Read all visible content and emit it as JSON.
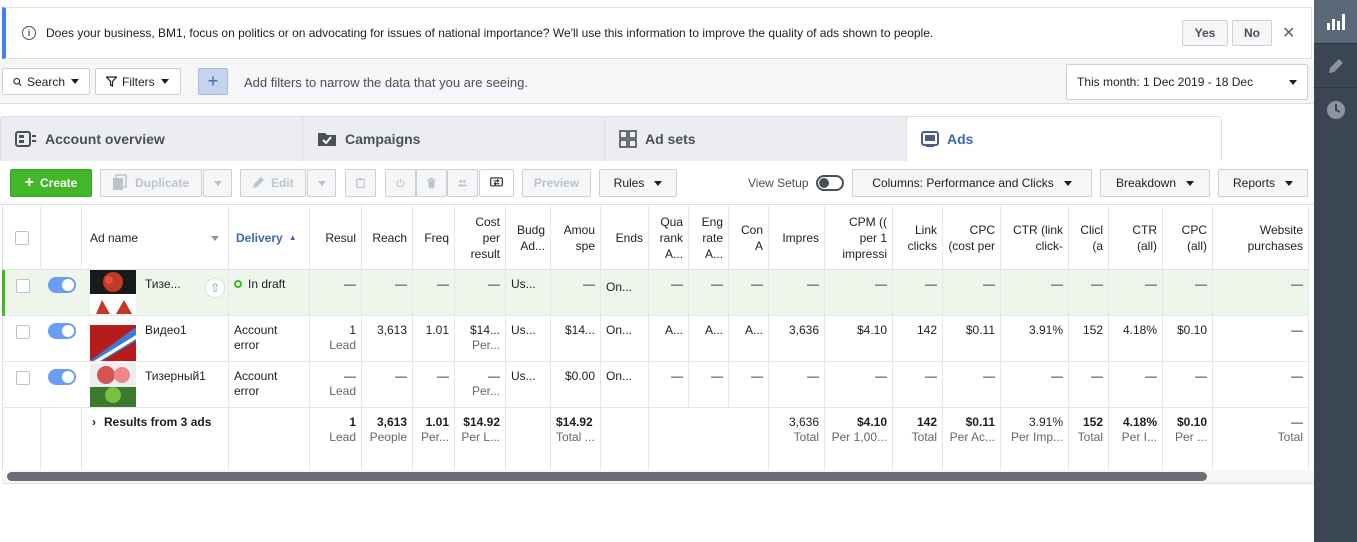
{
  "notice": {
    "message": "Does your business, BM1, focus on politics or on advocating for issues of national importance? We'll use this information to improve the quality of ads shown to people.",
    "yes_label": "Yes",
    "no_label": "No",
    "close": "✕"
  },
  "filterbar": {
    "search_label": "Search",
    "filters_label": "Filters",
    "plus_label": "+",
    "hint": "Add filters to narrow the data that you are seeing.",
    "date_range": "This month: 1 Dec 2019 - 18 Dec"
  },
  "tabs": [
    {
      "label": "Account overview",
      "icon": "account-overview-icon"
    },
    {
      "label": "Campaigns",
      "icon": "folder-icon"
    },
    {
      "label": "Ad sets",
      "icon": "grid-icon"
    },
    {
      "label": "Ads",
      "icon": "ad-icon",
      "active": true
    }
  ],
  "toolbar": {
    "create_label": "Create",
    "duplicate_label": "Duplicate",
    "edit_label": "Edit",
    "preview_label": "Preview",
    "rules_label": "Rules",
    "view_setup_label": "View Setup",
    "columns_label": "Columns: Performance and Clicks",
    "breakdown_label": "Breakdown",
    "reports_label": "Reports"
  },
  "table": {
    "headers": {
      "ad_name": "Ad name",
      "delivery": "Delivery",
      "result": "Resul",
      "reach": "Reach",
      "freq": "Freq",
      "cost_per_result": "Cost per result",
      "budget": "Budg Ad...",
      "amount_spent": "Amou spe",
      "ends": "Ends",
      "quality": "Qua rank A...",
      "engagement": "Eng rate A...",
      "conversion": "Con A",
      "impressions": "Impres",
      "cpm": "CPM (( per 1 impressi",
      "link_clicks": "Link clicks",
      "cpc_cost": "CPC (cost per",
      "ctr_link": "CTR (link click-",
      "clicks_all": "Clicl (a",
      "ctr_all": "CTR (all)",
      "cpc_all": "CPC (all)",
      "website_purchases": "Website purchases"
    },
    "rows": [
      {
        "name": "Тизе...",
        "delivery": "In draft",
        "result": "—",
        "result_sub": "",
        "reach": "—",
        "freq": "—",
        "cost": "—",
        "cost_sub": "",
        "budget": "Us...",
        "spent": "—",
        "ends": "On...",
        "quality": "—",
        "engagement": "—",
        "conversion": "—",
        "impressions": "—",
        "cpm": "—",
        "link_clicks": "—",
        "cpc": "—",
        "ctr_link": "—",
        "clicks_all": "—",
        "ctr_all": "—",
        "cpc_all": "—",
        "purchases": "—"
      },
      {
        "name": "Видео1",
        "delivery": "Account error",
        "result": "1",
        "result_sub": "Lead",
        "reach": "3,613",
        "freq": "1.01",
        "cost": "$14...",
        "cost_sub": "Per...",
        "budget": "Us...",
        "spent": "$14...",
        "ends": "On...",
        "quality": "A...",
        "engagement": "A...",
        "conversion": "A...",
        "impressions": "3,636",
        "cpm": "$4.10",
        "link_clicks": "142",
        "cpc": "$0.11",
        "ctr_link": "3.91%",
        "clicks_all": "152",
        "ctr_all": "4.18%",
        "cpc_all": "$0.10",
        "purchases": "—"
      },
      {
        "name": "Тизерный1",
        "delivery": "Account error",
        "result": "—",
        "result_sub": "Lead",
        "reach": "—",
        "freq": "—",
        "cost": "—",
        "cost_sub": "Per...",
        "budget": "Us...",
        "spent": "$0.00",
        "ends": "On...",
        "quality": "—",
        "engagement": "—",
        "conversion": "—",
        "impressions": "—",
        "cpm": "—",
        "link_clicks": "—",
        "cpc": "—",
        "ctr_link": "—",
        "clicks_all": "—",
        "ctr_all": "—",
        "cpc_all": "—",
        "purchases": "—"
      }
    ],
    "totals": {
      "label": "Results from 3 ads",
      "result": "1",
      "result_sub": "Lead",
      "reach": "3,613",
      "reach_sub": "People",
      "freq": "1.01",
      "freq_sub": "Per...",
      "cost": "$14.92",
      "cost_sub": "Per L...",
      "spent": "$14.92",
      "spent_sub": "Total ...",
      "impressions": "3,636",
      "impressions_sub": "Total",
      "cpm": "$4.10",
      "cpm_sub": "Per 1,00...",
      "link_clicks": "142",
      "link_clicks_sub": "Total",
      "cpc": "$0.11",
      "cpc_sub": "Per Ac...",
      "ctr_link": "3.91%",
      "ctr_link_sub": "Per Imp...",
      "clicks_all": "152",
      "clicks_all_sub": "Total",
      "ctr_all": "4.18%",
      "ctr_all_sub": "Per I...",
      "cpc_all": "$0.10",
      "cpc_all_sub": "Per ...",
      "purchases": "—",
      "purchases_sub": "Total"
    }
  },
  "colors": {
    "accent": "#4267b2",
    "create_green": "#42b72a",
    "draft_green": "#42b72a",
    "rail": "#3b4654"
  }
}
